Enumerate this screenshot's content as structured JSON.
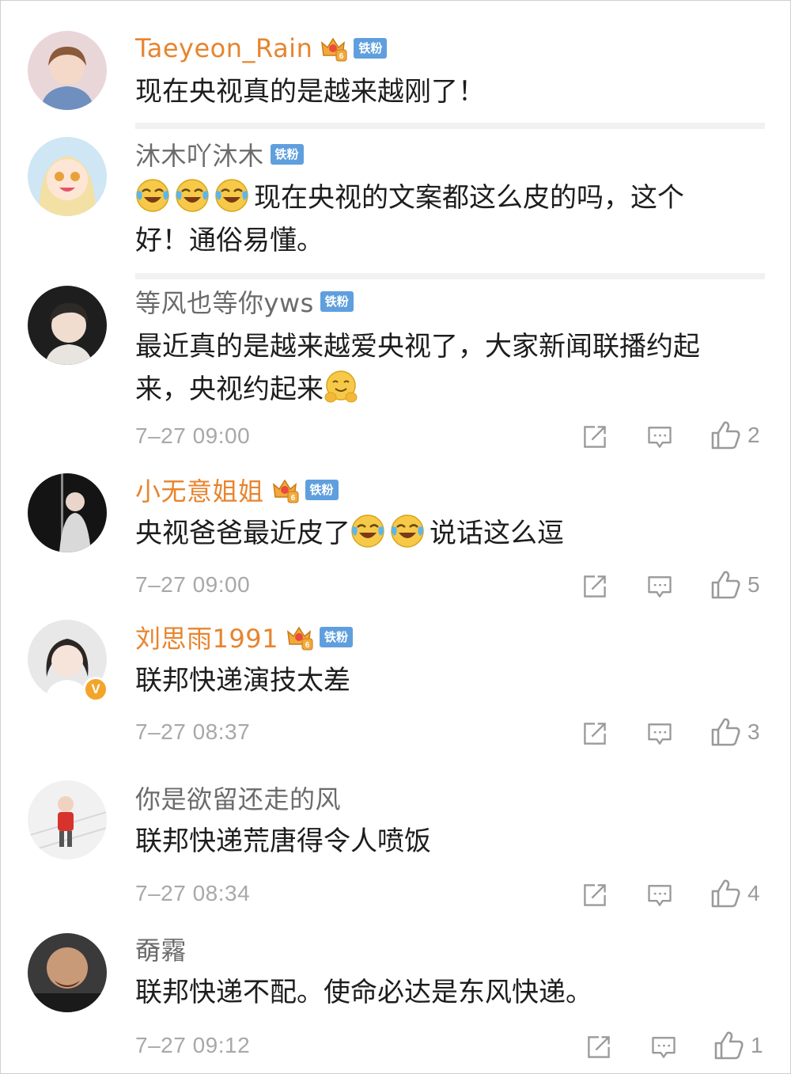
{
  "badge_label": "铁粉",
  "verified_mark": "V",
  "colors": {
    "vip_name": "#e8842e",
    "normal_name": "#6b6b6b",
    "fan_badge": "#5f9fde",
    "crown": "#f2a93b",
    "meta": "#a8a8a8"
  },
  "icons": [
    "crown-icon",
    "laughing-crying-emoji",
    "hug-emoji",
    "share-icon",
    "comment-icon",
    "like-icon"
  ],
  "comments": [
    {
      "user": "Taeyeon_Rain",
      "text": "现在央视真的是越来越刚了！"
    },
    {
      "user": "沐木吖沐木",
      "text_line1": "现在央视的文案都这么皮的吗，这个",
      "text_line2": "好！通俗易懂。"
    },
    {
      "user": "等风也等你yws",
      "text_line1": "最近真的是越来越爱央视了，大家新闻联播约起",
      "text_line2": "来，央视约起来",
      "time": "7–27 09:00",
      "likes": "2"
    },
    {
      "user": "小无意姐姐",
      "text_a": "央视爸爸最近皮了",
      "text_b": "说话这么逗",
      "time": "7–27 09:00",
      "likes": "5"
    },
    {
      "user": "刘思雨1991",
      "text": "联邦快递演技太差",
      "time": "7–27 08:37",
      "likes": "3"
    },
    {
      "user": "你是欲留还走的风",
      "text": "联邦快递荒唐得令人喷饭",
      "time": "7–27 08:34",
      "likes": "4"
    },
    {
      "user": "奣霿",
      "text": "联邦快递不配。使命必达是东风快递。",
      "time": "7–27 09:12",
      "likes": "1"
    }
  ]
}
